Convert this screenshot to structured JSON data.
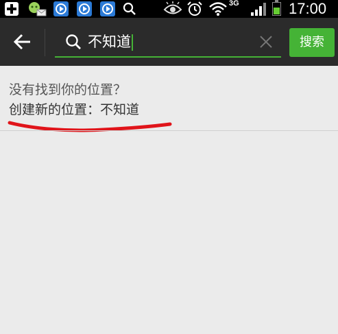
{
  "status_bar": {
    "network": "3G",
    "time": "17:00",
    "icons": [
      "plus-icon",
      "chat-icon",
      "app-icon",
      "app-icon",
      "app-icon",
      "search-icon",
      "eye-icon",
      "alarm-icon",
      "wifi-icon",
      "signal-icon",
      "battery-icon"
    ],
    "battery_level": 0.55,
    "colors": {
      "app_icon": "#2b7ad6",
      "battery_fill": "#66cc33"
    }
  },
  "search_bar": {
    "query": "不知道",
    "search_button": "搜索",
    "colors": {
      "background": "#2b2b2b",
      "accent": "#45b336"
    }
  },
  "content": {
    "not_found_text": "没有找到你的位置？",
    "create_location": "创建新的位置：不知道",
    "colors": {
      "highlight_underline": "#e0141a",
      "background": "#ebebeb"
    }
  }
}
